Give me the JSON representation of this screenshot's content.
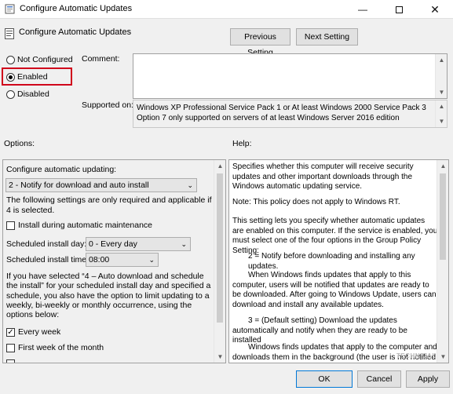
{
  "window": {
    "title": "Configure Automatic Updates",
    "minimize_icon": "minimize-icon",
    "maximize_icon": "maximize-icon",
    "close_icon": "close-icon"
  },
  "header": {
    "policy_title": "Configure Automatic Updates",
    "previous_label": "Previous Setting",
    "next_label": "Next Setting"
  },
  "state": {
    "options": [
      {
        "label": "Not Configured",
        "selected": false
      },
      {
        "label": "Enabled",
        "selected": true
      },
      {
        "label": "Disabled",
        "selected": false
      }
    ]
  },
  "comment": {
    "label": "Comment:",
    "value": ""
  },
  "supported": {
    "label": "Supported on:",
    "text": "Windows XP Professional Service Pack 1 or At least Windows 2000 Service Pack 3 Option 7 only supported on servers of at least Windows Server 2016 edition"
  },
  "options_pane": {
    "label": "Options:",
    "configure_label": "Configure automatic updating:",
    "configure_value": "2 - Notify for download and auto install",
    "following_note": "The following settings are only required and applicable if 4 is selected.",
    "maintenance_label": "Install during automatic maintenance",
    "maintenance_checked": false,
    "day_label": "Scheduled install day:",
    "day_value": "0 - Every day",
    "time_label": "Scheduled install time:",
    "time_value": "08:00",
    "schedule_note": "If you have selected “4 – Auto download and schedule the install” for your scheduled install day and specified a schedule, you also have the option to limit updating to a weekly, bi-weekly or monthly occurrence, using the options below:",
    "every_week_label": "Every week",
    "every_week_checked": true,
    "first_week_label": "First week of the month",
    "first_week_checked": false
  },
  "help_pane": {
    "label": "Help:",
    "paragraphs": [
      "Specifies whether this computer will receive security updates and other important downloads through the Windows automatic updating service.",
      "Note: This policy does not apply to Windows RT.",
      "This setting lets you specify whether automatic updates are enabled on this computer. If the service is enabled, you must select one of the four options in the Group Policy Setting:",
      "2 = Notify before downloading and installing any updates.",
      "When Windows finds updates that apply to this computer, users will be notified that updates are ready to be downloaded. After going to Windows Update, users can download and install any available updates.",
      "3 = (Default setting) Download the updates automatically and notify when they are ready to be installed",
      "Windows finds updates that apply to the computer and downloads them in the background (the user is not notified or"
    ]
  },
  "footer": {
    "ok_label": "OK",
    "cancel_label": "Cancel",
    "apply_label": "Apply",
    "watermark": "TECHNICAL"
  }
}
